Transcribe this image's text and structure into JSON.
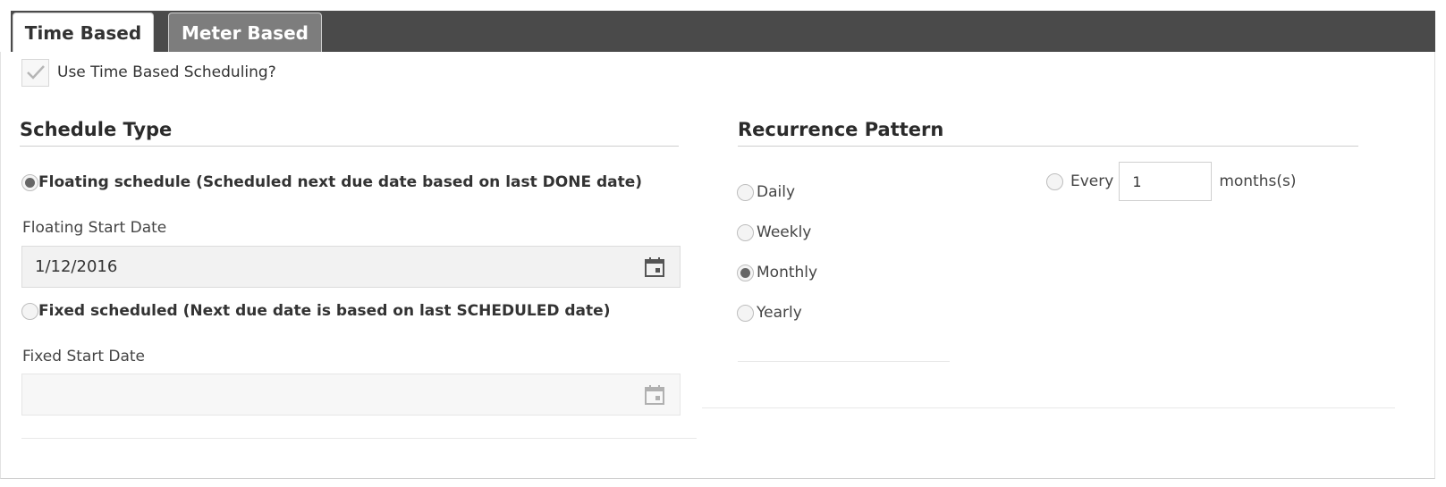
{
  "tabs": [
    {
      "label": "Time Based",
      "active": true
    },
    {
      "label": "Meter Based",
      "active": false
    }
  ],
  "use_scheduling": {
    "label": "Use Time Based Scheduling?",
    "checked": true
  },
  "schedule_type": {
    "title": "Schedule Type",
    "floating": {
      "label": "Floating schedule (Scheduled next due date based on last DONE date)",
      "checked": true,
      "start_label": "Floating Start Date",
      "start_value": "1/12/2016"
    },
    "fixed": {
      "label": "Fixed scheduled (Next due date is based on last SCHEDULED date)",
      "checked": false,
      "start_label": "Fixed Start Date",
      "start_value": ""
    }
  },
  "recurrence": {
    "title": "Recurrence Pattern",
    "options": [
      {
        "label": "Daily",
        "checked": false
      },
      {
        "label": "Weekly",
        "checked": false
      },
      {
        "label": "Monthly",
        "checked": true
      },
      {
        "label": "Yearly",
        "checked": false
      }
    ],
    "every": {
      "label": "Every",
      "value": "1",
      "unit": "months(s)",
      "checked": false
    }
  },
  "icons": {
    "checkbox": "check-icon",
    "date": "calendar-icon"
  },
  "colors": {
    "tabbar": "#4a4a4a",
    "tab_inactive": "#7d7d7d",
    "text": "#333333"
  }
}
